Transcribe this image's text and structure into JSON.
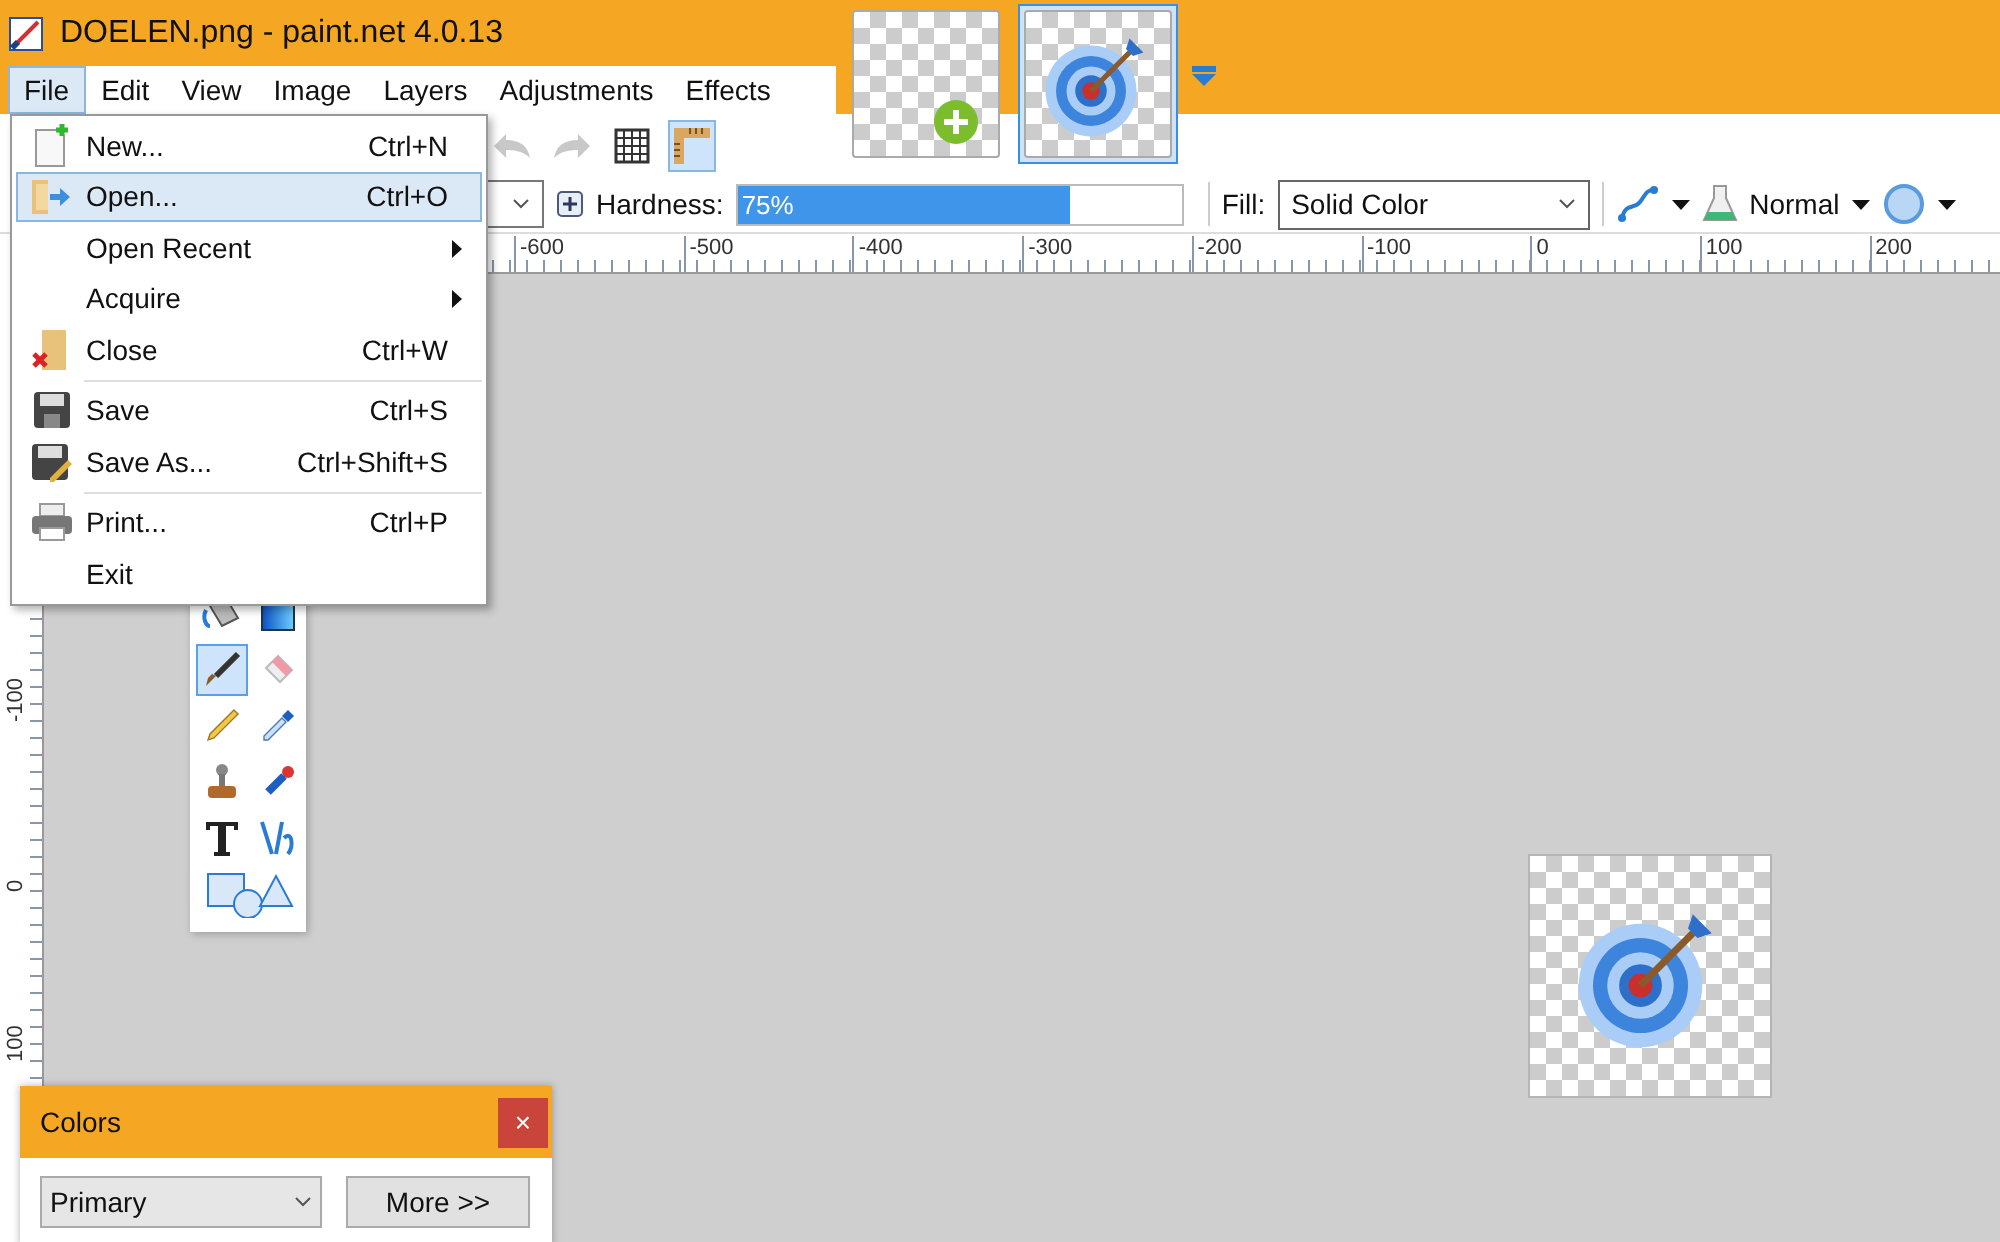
{
  "window": {
    "title": "DOELEN.png - paint.net 4.0.13"
  },
  "menu_bar": [
    {
      "label": "File",
      "selected": true
    },
    {
      "label": "Edit",
      "selected": false
    },
    {
      "label": "View",
      "selected": false
    },
    {
      "label": "Image",
      "selected": false
    },
    {
      "label": "Layers",
      "selected": false
    },
    {
      "label": "Adjustments",
      "selected": false
    },
    {
      "label": "Effects",
      "selected": false
    }
  ],
  "image_tabs": [
    {
      "kind": "add",
      "selected": false
    },
    {
      "kind": "target",
      "selected": true
    }
  ],
  "toolbar": [
    {
      "kind": "undo",
      "selected": false
    },
    {
      "kind": "redo",
      "selected": false
    },
    {
      "kind": "grid",
      "selected": false
    },
    {
      "kind": "rulers",
      "selected": true
    }
  ],
  "tool_options": {
    "hardness": {
      "label": "Hardness:",
      "reading": "75%",
      "level": 0.75
    },
    "fill": {
      "label": "Fill:",
      "value": "Solid Color"
    },
    "blend_mode": {
      "value": "Normal"
    }
  },
  "file_menu": [
    {
      "kind": "new",
      "label": "New...",
      "shortcut": "Ctrl+N",
      "selected": false
    },
    {
      "kind": "open",
      "label": "Open...",
      "shortcut": "Ctrl+O",
      "selected": true
    },
    {
      "kind": "submenu",
      "label": "Open Recent",
      "selected": false
    },
    {
      "kind": "submenu",
      "label": "Acquire",
      "selected": false
    },
    {
      "kind": "close",
      "label": "Close",
      "shortcut": "Ctrl+W",
      "selected": false
    },
    {
      "kind": "separator"
    },
    {
      "kind": "save",
      "label": "Save",
      "shortcut": "Ctrl+S",
      "selected": false
    },
    {
      "kind": "save_as",
      "label": "Save As...",
      "shortcut": "Ctrl+Shift+S",
      "selected": false
    },
    {
      "kind": "separator"
    },
    {
      "kind": "print",
      "label": "Print...",
      "shortcut": "Ctrl+P",
      "selected": false
    },
    {
      "kind": "plain",
      "label": "Exit",
      "selected": false
    }
  ],
  "rulers": {
    "horizontal": [
      "-600",
      "-500",
      "-400",
      "-300",
      "-200",
      "-100",
      "0",
      "100",
      "200"
    ],
    "vertical": [
      "-100",
      "0",
      "100"
    ]
  },
  "tools": [
    {
      "kind": "bucket",
      "selected": false
    },
    {
      "kind": "gradient",
      "selected": false
    },
    {
      "kind": "brush",
      "selected": true
    },
    {
      "kind": "eraser",
      "selected": false
    },
    {
      "kind": "pencil",
      "selected": false
    },
    {
      "kind": "picker",
      "selected": false
    },
    {
      "kind": "stamp",
      "selected": false
    },
    {
      "kind": "recolor",
      "selected": false
    },
    {
      "kind": "text",
      "selected": false
    },
    {
      "kind": "line",
      "selected": false
    },
    {
      "kind": "shapes",
      "selected": false
    }
  ],
  "colors_panel": {
    "title": "Colors",
    "close": "×",
    "mode": "Primary",
    "more_button": "More >>"
  }
}
